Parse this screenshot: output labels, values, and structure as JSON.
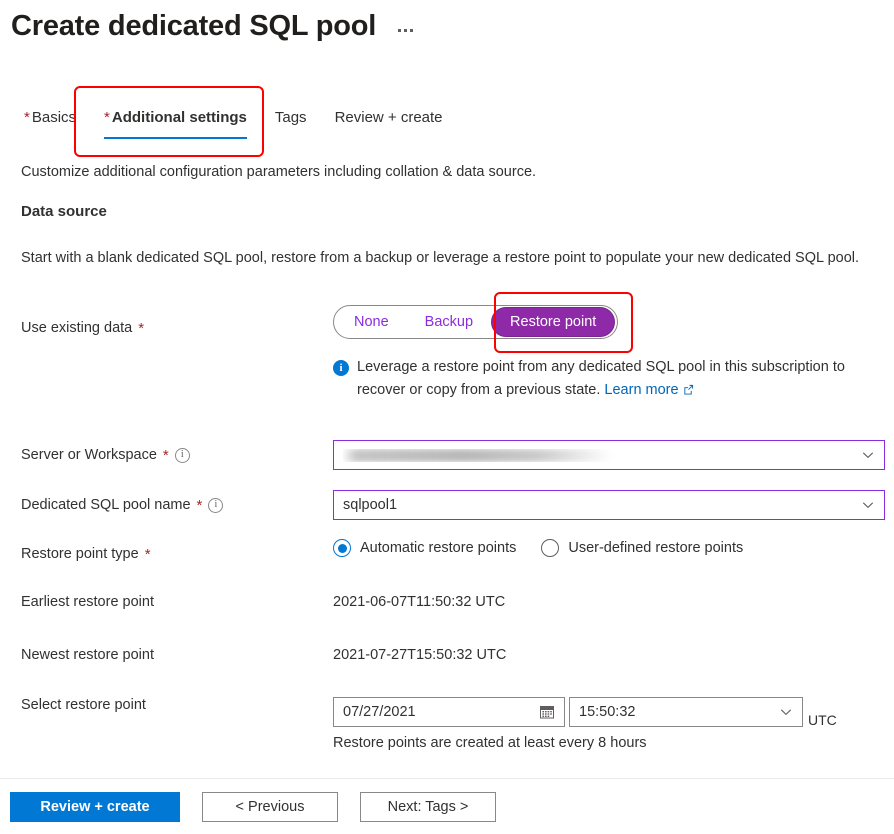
{
  "header": {
    "title": "Create dedicated SQL pool",
    "more_label": "More"
  },
  "tabs": [
    {
      "label": "Basics",
      "required": "*",
      "selected": false
    },
    {
      "label": "Additional settings",
      "required": "*",
      "selected": true
    },
    {
      "label": "Tags",
      "required": "",
      "selected": false
    },
    {
      "label": "Review + create",
      "required": "",
      "selected": false
    }
  ],
  "subtitle": "Customize additional configuration parameters including collation & data source.",
  "data_source": {
    "heading": "Data source",
    "description": "Start with a blank dedicated SQL pool, restore from a backup or leverage a restore point to populate your new dedicated SQL pool.",
    "use_existing_data": {
      "label": "Use existing data",
      "required": "*",
      "options": [
        "None",
        "Backup",
        "Restore point"
      ],
      "selected": "Restore point"
    },
    "callout": {
      "icon": "info-icon",
      "text": "Leverage a restore point from any dedicated SQL pool in this subscription to recover or copy from a previous state.",
      "link_label": "Learn more"
    }
  },
  "fields": {
    "server_or_workspace": {
      "label": "Server or Workspace",
      "required": "*",
      "info": "i",
      "value": "",
      "redacted": true
    },
    "pool_name": {
      "label": "Dedicated SQL pool name",
      "required": "*",
      "info": "i",
      "value": "sqlpool1"
    },
    "restore_point_type": {
      "label": "Restore point type",
      "required": "*",
      "options": [
        {
          "label": "Automatic restore points",
          "selected": true
        },
        {
          "label": "User-defined restore points",
          "selected": false
        }
      ]
    },
    "earliest_restore_point": {
      "label": "Earliest restore point",
      "value": "2021-06-07T11:50:32 UTC"
    },
    "newest_restore_point": {
      "label": "Newest restore point",
      "value": "2021-07-27T15:50:32 UTC"
    },
    "select_restore_point": {
      "label": "Select restore point",
      "date_value": "07/27/2021",
      "time_value": "15:50:32",
      "timezone": "UTC",
      "hint": "Restore points are created at least every 8 hours"
    }
  },
  "footer": {
    "review_create": "Review + create",
    "previous": "< Previous",
    "next": "Next: Tags >"
  },
  "colors": {
    "accent_blue": "#0078d4",
    "purple": "#8e2aa8",
    "required_red": "#a4262c",
    "annotation_red": "#ff0000",
    "link_blue": "#0067b8"
  }
}
